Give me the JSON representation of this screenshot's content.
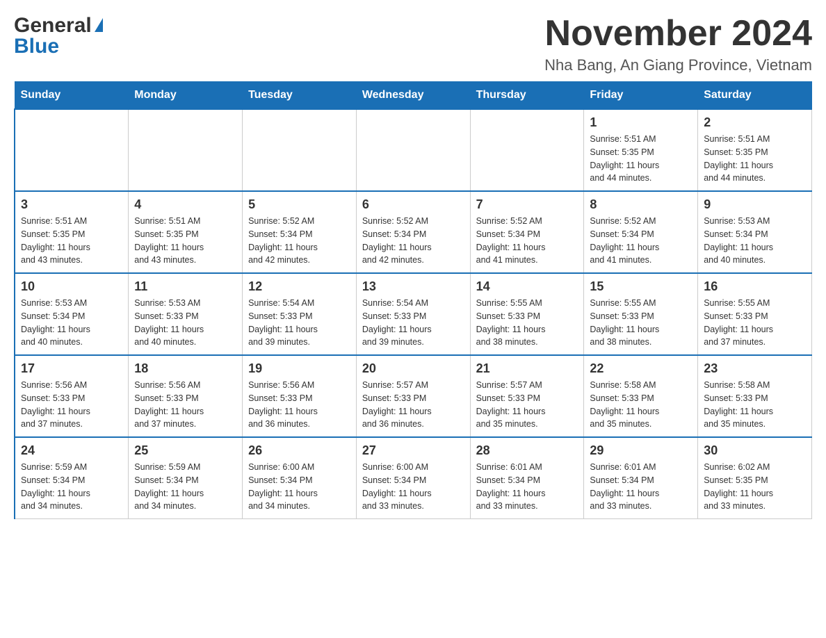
{
  "header": {
    "logo_general": "General",
    "logo_blue": "Blue",
    "month_title": "November 2024",
    "subtitle": "Nha Bang, An Giang Province, Vietnam"
  },
  "days_of_week": [
    "Sunday",
    "Monday",
    "Tuesday",
    "Wednesday",
    "Thursday",
    "Friday",
    "Saturday"
  ],
  "weeks": [
    {
      "days": [
        {
          "number": "",
          "info": "",
          "empty": true
        },
        {
          "number": "",
          "info": "",
          "empty": true
        },
        {
          "number": "",
          "info": "",
          "empty": true
        },
        {
          "number": "",
          "info": "",
          "empty": true
        },
        {
          "number": "",
          "info": "",
          "empty": true
        },
        {
          "number": "1",
          "info": "Sunrise: 5:51 AM\nSunset: 5:35 PM\nDaylight: 11 hours\nand 44 minutes."
        },
        {
          "number": "2",
          "info": "Sunrise: 5:51 AM\nSunset: 5:35 PM\nDaylight: 11 hours\nand 44 minutes."
        }
      ]
    },
    {
      "days": [
        {
          "number": "3",
          "info": "Sunrise: 5:51 AM\nSunset: 5:35 PM\nDaylight: 11 hours\nand 43 minutes."
        },
        {
          "number": "4",
          "info": "Sunrise: 5:51 AM\nSunset: 5:35 PM\nDaylight: 11 hours\nand 43 minutes."
        },
        {
          "number": "5",
          "info": "Sunrise: 5:52 AM\nSunset: 5:34 PM\nDaylight: 11 hours\nand 42 minutes."
        },
        {
          "number": "6",
          "info": "Sunrise: 5:52 AM\nSunset: 5:34 PM\nDaylight: 11 hours\nand 42 minutes."
        },
        {
          "number": "7",
          "info": "Sunrise: 5:52 AM\nSunset: 5:34 PM\nDaylight: 11 hours\nand 41 minutes."
        },
        {
          "number": "8",
          "info": "Sunrise: 5:52 AM\nSunset: 5:34 PM\nDaylight: 11 hours\nand 41 minutes."
        },
        {
          "number": "9",
          "info": "Sunrise: 5:53 AM\nSunset: 5:34 PM\nDaylight: 11 hours\nand 40 minutes."
        }
      ]
    },
    {
      "days": [
        {
          "number": "10",
          "info": "Sunrise: 5:53 AM\nSunset: 5:34 PM\nDaylight: 11 hours\nand 40 minutes."
        },
        {
          "number": "11",
          "info": "Sunrise: 5:53 AM\nSunset: 5:33 PM\nDaylight: 11 hours\nand 40 minutes."
        },
        {
          "number": "12",
          "info": "Sunrise: 5:54 AM\nSunset: 5:33 PM\nDaylight: 11 hours\nand 39 minutes."
        },
        {
          "number": "13",
          "info": "Sunrise: 5:54 AM\nSunset: 5:33 PM\nDaylight: 11 hours\nand 39 minutes."
        },
        {
          "number": "14",
          "info": "Sunrise: 5:55 AM\nSunset: 5:33 PM\nDaylight: 11 hours\nand 38 minutes."
        },
        {
          "number": "15",
          "info": "Sunrise: 5:55 AM\nSunset: 5:33 PM\nDaylight: 11 hours\nand 38 minutes."
        },
        {
          "number": "16",
          "info": "Sunrise: 5:55 AM\nSunset: 5:33 PM\nDaylight: 11 hours\nand 37 minutes."
        }
      ]
    },
    {
      "days": [
        {
          "number": "17",
          "info": "Sunrise: 5:56 AM\nSunset: 5:33 PM\nDaylight: 11 hours\nand 37 minutes."
        },
        {
          "number": "18",
          "info": "Sunrise: 5:56 AM\nSunset: 5:33 PM\nDaylight: 11 hours\nand 37 minutes."
        },
        {
          "number": "19",
          "info": "Sunrise: 5:56 AM\nSunset: 5:33 PM\nDaylight: 11 hours\nand 36 minutes."
        },
        {
          "number": "20",
          "info": "Sunrise: 5:57 AM\nSunset: 5:33 PM\nDaylight: 11 hours\nand 36 minutes."
        },
        {
          "number": "21",
          "info": "Sunrise: 5:57 AM\nSunset: 5:33 PM\nDaylight: 11 hours\nand 35 minutes."
        },
        {
          "number": "22",
          "info": "Sunrise: 5:58 AM\nSunset: 5:33 PM\nDaylight: 11 hours\nand 35 minutes."
        },
        {
          "number": "23",
          "info": "Sunrise: 5:58 AM\nSunset: 5:33 PM\nDaylight: 11 hours\nand 35 minutes."
        }
      ]
    },
    {
      "days": [
        {
          "number": "24",
          "info": "Sunrise: 5:59 AM\nSunset: 5:34 PM\nDaylight: 11 hours\nand 34 minutes."
        },
        {
          "number": "25",
          "info": "Sunrise: 5:59 AM\nSunset: 5:34 PM\nDaylight: 11 hours\nand 34 minutes."
        },
        {
          "number": "26",
          "info": "Sunrise: 6:00 AM\nSunset: 5:34 PM\nDaylight: 11 hours\nand 34 minutes."
        },
        {
          "number": "27",
          "info": "Sunrise: 6:00 AM\nSunset: 5:34 PM\nDaylight: 11 hours\nand 33 minutes."
        },
        {
          "number": "28",
          "info": "Sunrise: 6:01 AM\nSunset: 5:34 PM\nDaylight: 11 hours\nand 33 minutes."
        },
        {
          "number": "29",
          "info": "Sunrise: 6:01 AM\nSunset: 5:34 PM\nDaylight: 11 hours\nand 33 minutes."
        },
        {
          "number": "30",
          "info": "Sunrise: 6:02 AM\nSunset: 5:35 PM\nDaylight: 11 hours\nand 33 minutes."
        }
      ]
    }
  ]
}
